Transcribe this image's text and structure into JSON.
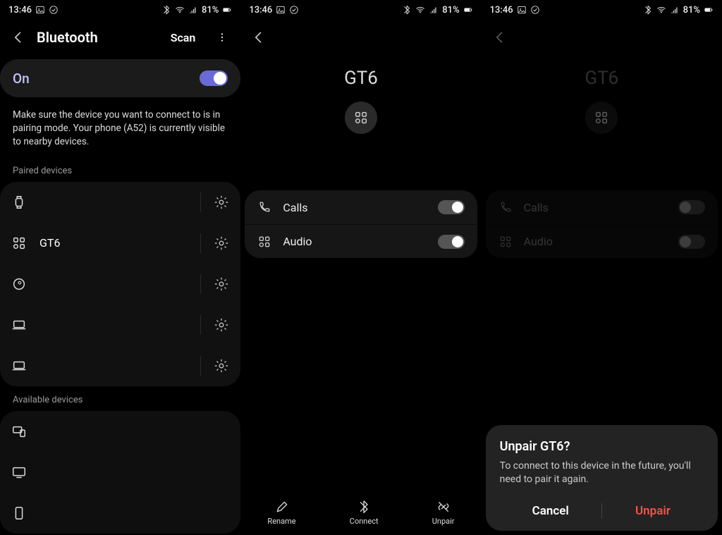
{
  "status": {
    "time": "13:46",
    "battery": "81%"
  },
  "screen1": {
    "title": "Bluetooth",
    "scan": "Scan",
    "on_label": "On",
    "info": "Make sure the device you want to connect to is in pairing mode. Your phone (A52) is currently visible to nearby devices.",
    "paired_label": "Paired devices",
    "paired": [
      {
        "icon": "watch",
        "label": ""
      },
      {
        "icon": "grid",
        "label": "GT6"
      },
      {
        "icon": "headphones",
        "label": ""
      },
      {
        "icon": "laptop",
        "label": ""
      },
      {
        "icon": "laptop",
        "label": ""
      }
    ],
    "available_label": "Available devices",
    "available": [
      {
        "icon": "tv-phone",
        "label": ""
      },
      {
        "icon": "tv",
        "label": ""
      },
      {
        "icon": "phone",
        "label": ""
      }
    ]
  },
  "screen2": {
    "device_name": "GT6",
    "options": {
      "calls": "Calls",
      "audio": "Audio"
    },
    "bottom": {
      "rename": "Rename",
      "connect": "Connect",
      "unpair": "Unpair"
    }
  },
  "screen3": {
    "device_name": "GT6",
    "options": {
      "calls": "Calls",
      "audio": "Audio"
    },
    "dialog": {
      "title": "Unpair GT6?",
      "message": "To connect to this device in the future, you'll need to pair it again.",
      "cancel": "Cancel",
      "confirm": "Unpair"
    }
  }
}
